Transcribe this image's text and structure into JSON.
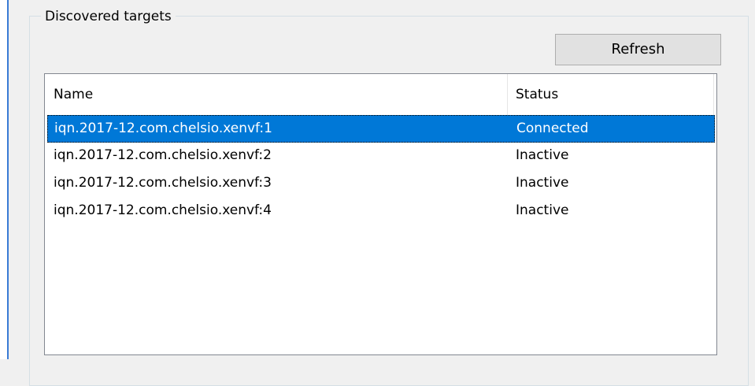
{
  "groupbox": {
    "title": "Discovered targets"
  },
  "toolbar": {
    "refresh_label": "Refresh"
  },
  "targets": {
    "columns": {
      "name": "Name",
      "status": "Status"
    },
    "rows": [
      {
        "name": "iqn.2017-12.com.chelsio.xenvf:1",
        "status": "Connected",
        "selected": true
      },
      {
        "name": "iqn.2017-12.com.chelsio.xenvf:2",
        "status": "Inactive",
        "selected": false
      },
      {
        "name": "iqn.2017-12.com.chelsio.xenvf:3",
        "status": "Inactive",
        "selected": false
      },
      {
        "name": "iqn.2017-12.com.chelsio.xenvf:4",
        "status": "Inactive",
        "selected": false
      }
    ]
  },
  "colors": {
    "selection": "#0078d7",
    "window_background": "#f0f0f0",
    "accent_rail": "#3a7bd5"
  }
}
